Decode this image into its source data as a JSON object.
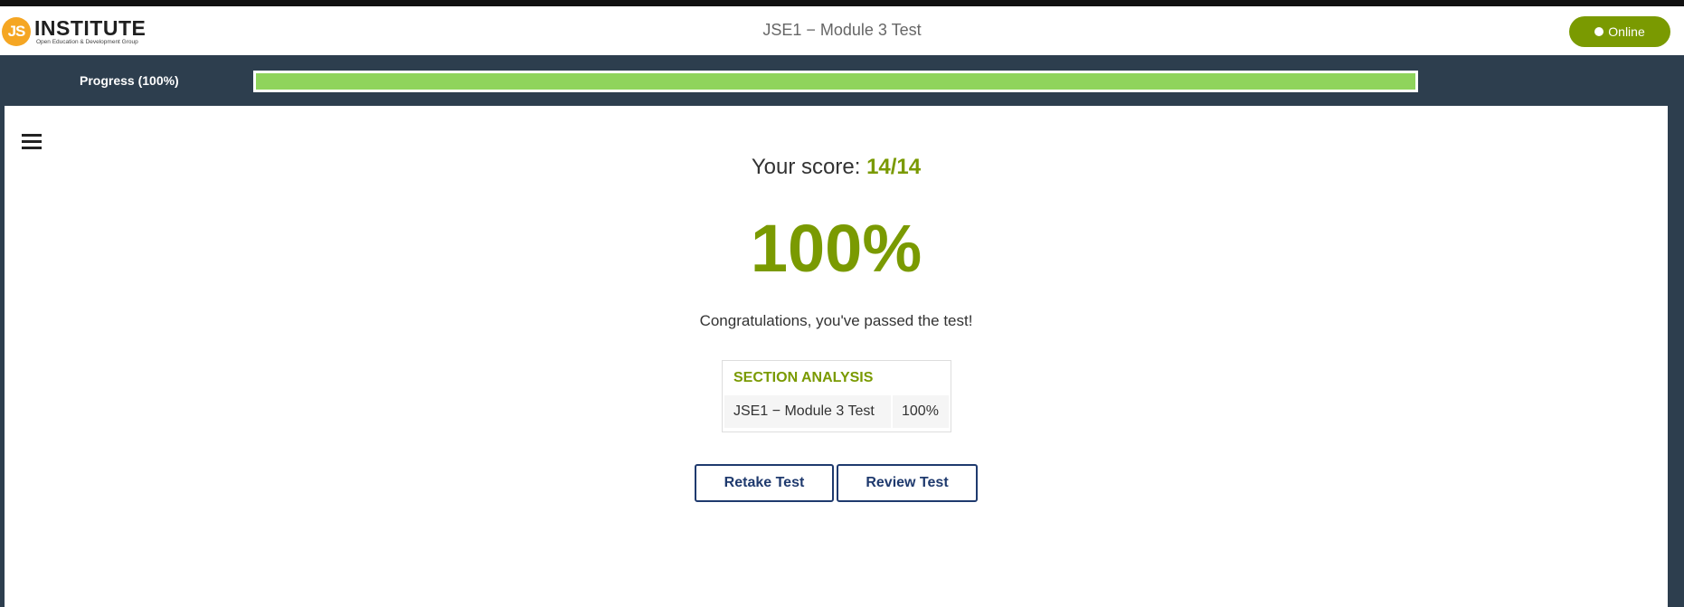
{
  "header": {
    "logo_badge": "JS",
    "logo_word": "INSTITUTE",
    "logo_tagline": "Open Education & Development Group",
    "title": "JSE1 − Module 3 Test",
    "status_label": "Online"
  },
  "progress": {
    "label": "Progress (100%)",
    "value_percent": 100
  },
  "result": {
    "score_prefix": "Your score:",
    "score_value": "14/14",
    "percent": "100%",
    "message": "Congratulations, you've passed the test!"
  },
  "section_analysis": {
    "title": "SECTION ANALYSIS",
    "rows": [
      {
        "name": "JSE1 − Module 3 Test",
        "value": "100%"
      }
    ]
  },
  "actions": {
    "retake_label": "Retake Test",
    "review_label": "Review Test"
  },
  "colors": {
    "accent": "#7a9a01",
    "progress_fill": "#8fd45c",
    "header_band": "#2d3e4e",
    "button_text": "#1f3a6e",
    "logo_badge": "#f5a623"
  },
  "icons": {
    "menu": "hamburger-menu-icon",
    "status": "status-dot-icon"
  }
}
